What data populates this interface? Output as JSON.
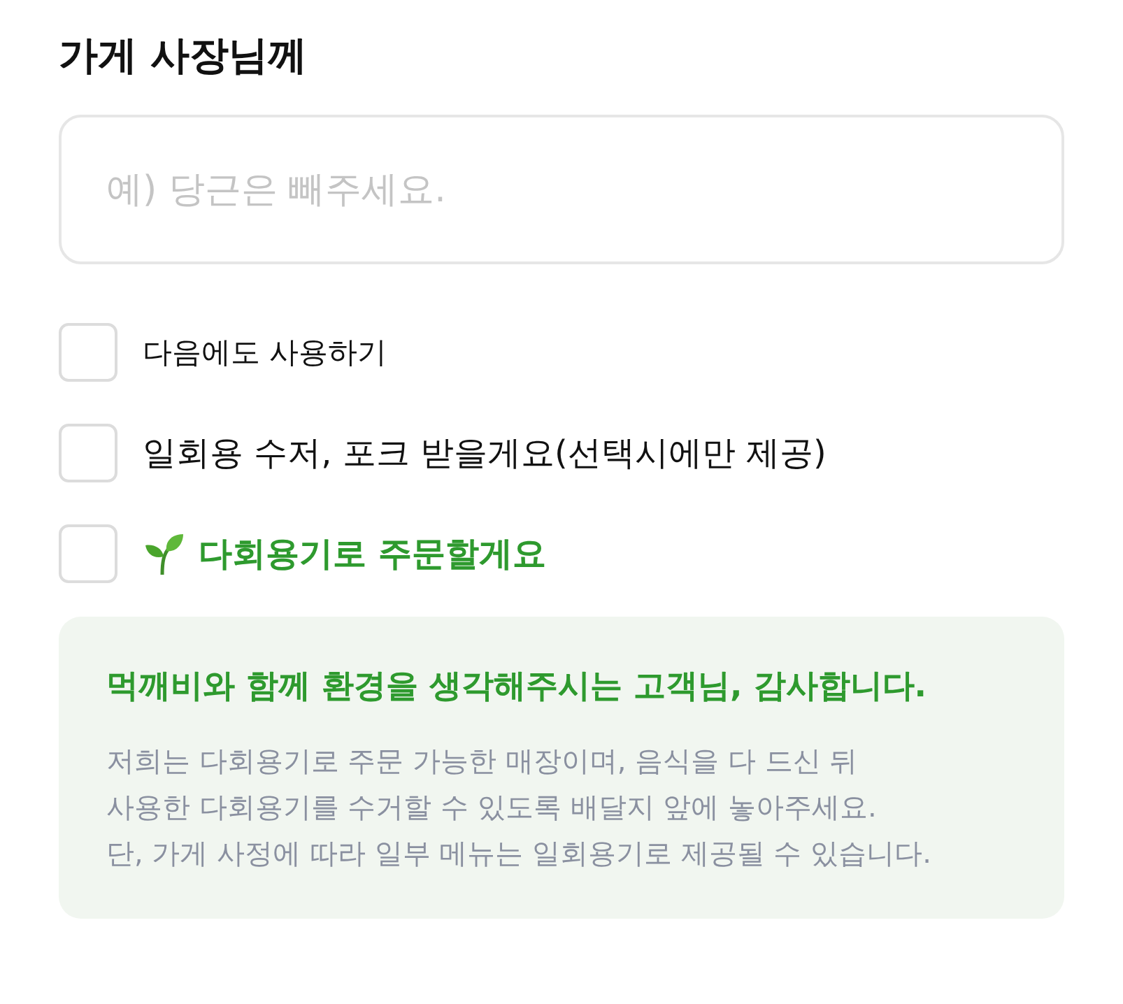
{
  "title": "가게 사장님께",
  "memo": {
    "placeholder": "예) 당근은 빼주세요."
  },
  "options": [
    {
      "kind": "remember",
      "label": "다음에도 사용하기",
      "checked": false
    },
    {
      "kind": "plain",
      "label": "일회용 수저, 포크 받을게요(선택시에만 제공)",
      "checked": false
    },
    {
      "kind": "eco",
      "label": "다회용기로 주문할게요",
      "checked": false
    }
  ],
  "info": {
    "heading": "먹깨비와 함께 환경을 생각해주시는 고객님, 감사합니다.",
    "lines": [
      "저희는 다회용기로 주문 가능한 매장이며, 음식을 다 드신 뒤",
      "사용한 다회용기를 수거할 수 있도록 배달지 앞에 놓아주세요.",
      "단, 가게 사정에 따라 일부 메뉴는 일회용기로 제공될 수 있습니다."
    ]
  }
}
